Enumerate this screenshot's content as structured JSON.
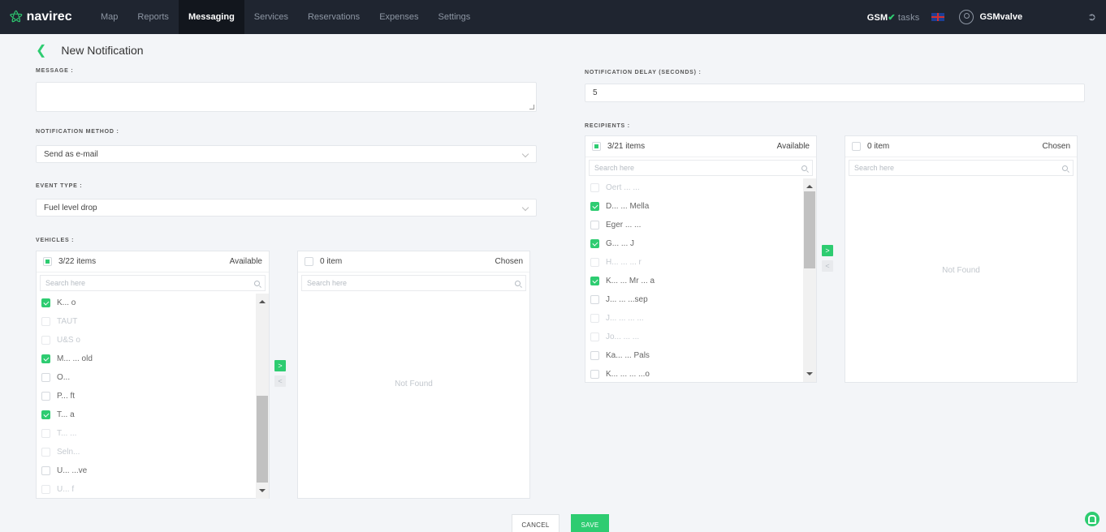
{
  "app": {
    "brand": "navirec",
    "brand_icon": "navirec-logo-icon"
  },
  "nav": {
    "items": [
      {
        "label": "Map",
        "active": false
      },
      {
        "label": "Reports",
        "active": false
      },
      {
        "label": "Messaging",
        "active": true
      },
      {
        "label": "Services",
        "active": false
      },
      {
        "label": "Reservations",
        "active": false
      },
      {
        "label": "Expenses",
        "active": false
      },
      {
        "label": "Settings",
        "active": false
      }
    ]
  },
  "header_right": {
    "gsm": "GSM",
    "gsm_check": "✔",
    "tasks": "tasks",
    "user": "GSMvalve",
    "flag_icon": "uk-flag-icon",
    "user_icon": "user-circle-icon",
    "logout_icon": "logout-icon"
  },
  "page": {
    "back_icon": "chevron-left-icon",
    "title": "New Notification"
  },
  "form": {
    "message_label": "MESSAGE :",
    "message_value": "",
    "delay_label": "NOTIFICATION DELAY (SECONDS) :",
    "delay_value": "5",
    "method_label": "NOTIFICATION METHOD :",
    "method_value": "Send as e-mail",
    "event_label": "EVENT TYPE :",
    "event_value": "Fuel level drop",
    "vehicles_label": "VEHICLES :",
    "recipients_label": "RECIPIENTS :"
  },
  "vehicles": {
    "available": {
      "count": "3/22 items",
      "title": "Available",
      "search_placeholder": "Search here",
      "items": [
        {
          "label": "K... o",
          "checked": true,
          "muted": false
        },
        {
          "label": "TAUT",
          "checked": false,
          "muted": true
        },
        {
          "label": "U&S o",
          "checked": false,
          "muted": true
        },
        {
          "label": "M... ... old",
          "checked": true,
          "muted": false
        },
        {
          "label": "O...",
          "checked": false,
          "muted": false
        },
        {
          "label": "P... ft",
          "checked": false,
          "muted": false
        },
        {
          "label": "T... a",
          "checked": true,
          "muted": false
        },
        {
          "label": "T... ...",
          "checked": false,
          "muted": true
        },
        {
          "label": "Seln...",
          "checked": false,
          "muted": true
        },
        {
          "label": "U... ...ve",
          "checked": false,
          "muted": false
        },
        {
          "label": "U... f",
          "checked": false,
          "muted": true
        }
      ],
      "scroll_thumb_fraction": 0.5
    },
    "chosen": {
      "count": "0 item",
      "title": "Chosen",
      "search_placeholder": "Search here",
      "empty_text": "Not Found"
    },
    "move_right": ">",
    "move_left": "<"
  },
  "recipients": {
    "available": {
      "count": "3/21 items",
      "title": "Available",
      "search_placeholder": "Search here",
      "items": [
        {
          "label": "Oert ... ...",
          "checked": false,
          "muted": true
        },
        {
          "label": "D... ... Mella",
          "checked": true,
          "muted": false
        },
        {
          "label": "Eger ... ...",
          "checked": false,
          "muted": false
        },
        {
          "label": "G... ... J",
          "checked": true,
          "muted": false
        },
        {
          "label": "H... ... ... r",
          "checked": false,
          "muted": true
        },
        {
          "label": "K... ... Mr ... a",
          "checked": true,
          "muted": false
        },
        {
          "label": "J... ... ...sep",
          "checked": false,
          "muted": false
        },
        {
          "label": "J... ... ... ...",
          "checked": false,
          "muted": true
        },
        {
          "label": "Jo... ... ...",
          "checked": false,
          "muted": true
        },
        {
          "label": "Ka... ... Pals",
          "checked": false,
          "muted": false
        },
        {
          "label": "K... ... ... ...o",
          "checked": false,
          "muted": false
        }
      ],
      "scroll_thumb_fraction": 0.45
    },
    "chosen": {
      "count": "0 item",
      "title": "Chosen",
      "search_placeholder": "Search here",
      "empty_text": "Not Found"
    },
    "move_right": ">",
    "move_left": "<"
  },
  "actions": {
    "cancel": "CANCEL",
    "save": "SAVE",
    "bell_icon": "notification-bell-icon"
  },
  "colors": {
    "accent": "#2ecc71",
    "topbar": "#1f2530",
    "background": "#f3f5f8"
  }
}
